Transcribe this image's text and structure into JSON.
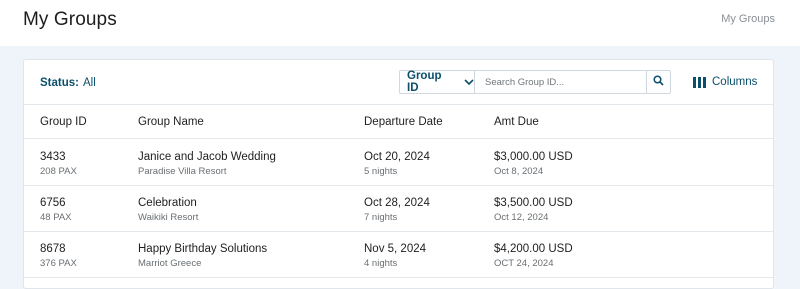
{
  "header": {
    "title": "My Groups",
    "breadcrumb": "My Groups"
  },
  "toolbar": {
    "status_label": "Status:",
    "status_value": "All",
    "id_select_label": "Group ID",
    "search_placeholder": "Search Group ID...",
    "columns_label": "Columns"
  },
  "table": {
    "headers": [
      "Group ID",
      "Group Name",
      "Departure Date",
      "Amt Due"
    ],
    "rows": [
      {
        "group_id": "3433",
        "pax": "208 PAX",
        "name": "Janice and Jacob Wedding",
        "resort": "Paradise Villa Resort",
        "departure": "Oct 20, 2024",
        "nights": "5 nights",
        "amount": "$3,000.00 USD",
        "due_date": "Oct 8, 2024"
      },
      {
        "group_id": "6756",
        "pax": "48 PAX",
        "name": "Celebration",
        "resort": "Waikiki Resort",
        "departure": "Oct 28, 2024",
        "nights": "7 nights",
        "amount": "$3,500.00 USD",
        "due_date": "Oct 12, 2024"
      },
      {
        "group_id": "8678",
        "pax": "376 PAX",
        "name": "Happy Birthday Solutions",
        "resort": "Marriot Greece",
        "departure": "Nov 5, 2024",
        "nights": "4 nights",
        "amount": "$4,200.00 USD",
        "due_date": "OCT 24, 2024"
      }
    ]
  },
  "colors": {
    "accent": "#0b4f6c",
    "background": "#eef4f9"
  }
}
